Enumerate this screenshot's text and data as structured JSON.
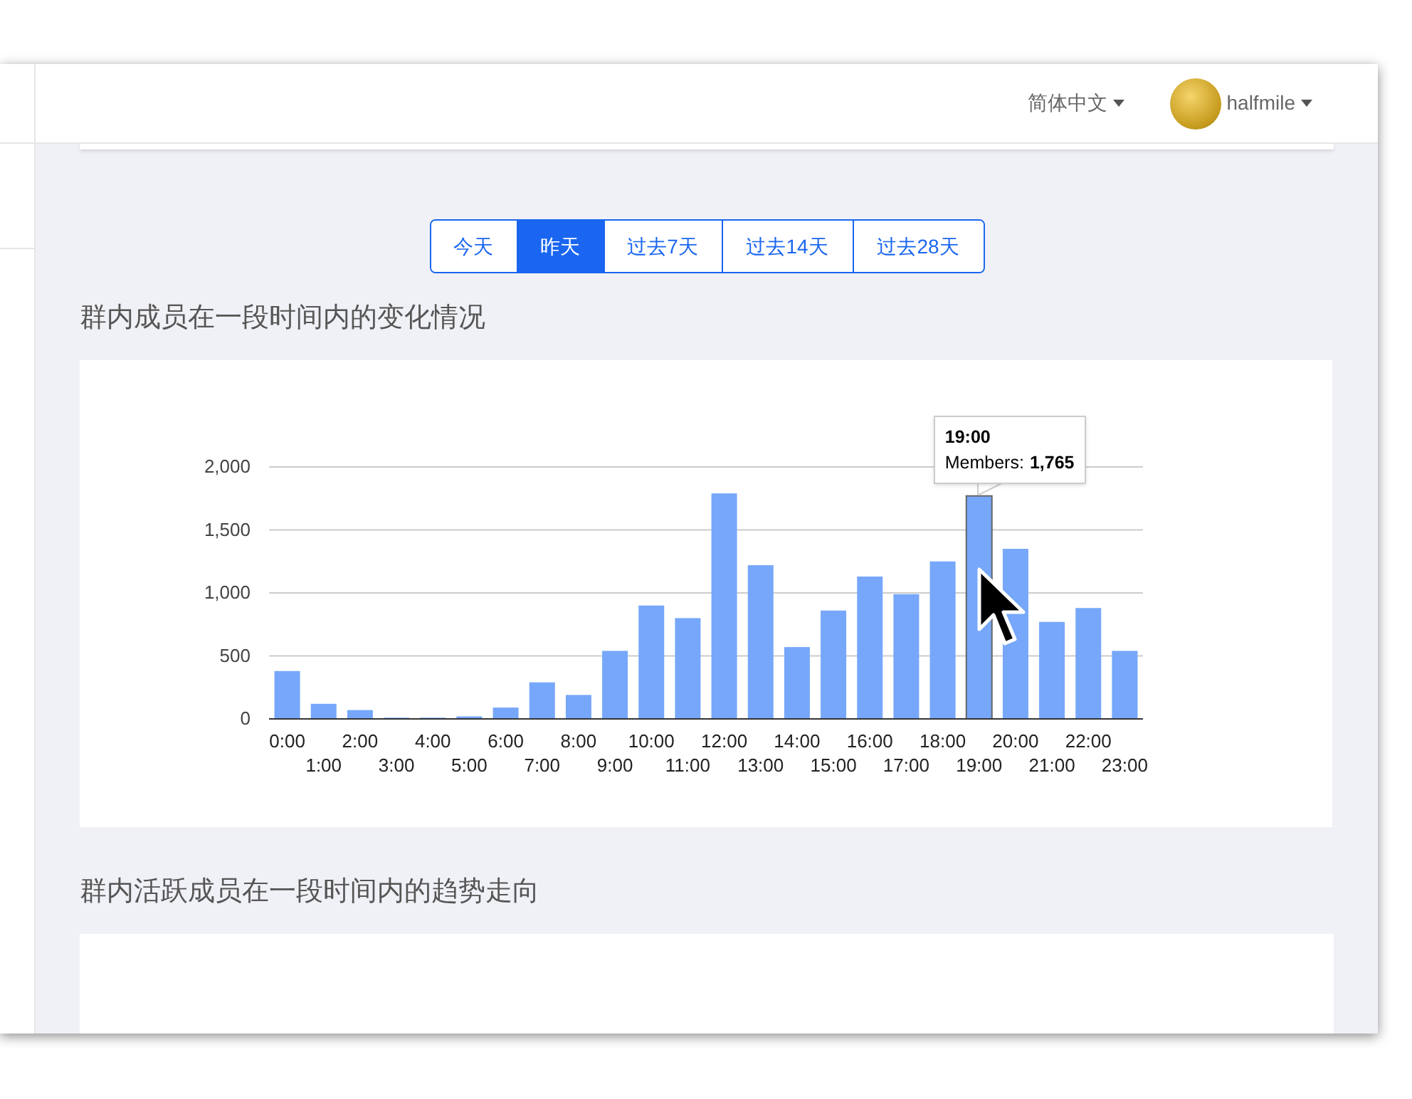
{
  "header": {
    "language": "简体中文",
    "user": "halfmile"
  },
  "range_tabs": [
    {
      "label": "今天",
      "selected": false
    },
    {
      "label": "昨天",
      "selected": true
    },
    {
      "label": "过去7天",
      "selected": false
    },
    {
      "label": "过去14天",
      "selected": false
    },
    {
      "label": "过去28天",
      "selected": false
    }
  ],
  "sections": [
    {
      "title": "群内成员在一段时间内的变化情况",
      "tooltip": {
        "title": "19:00",
        "label": "Members:",
        "value": "1,765"
      },
      "chart_data": {
        "type": "bar",
        "categories": [
          "0:00",
          "1:00",
          "2:00",
          "3:00",
          "4:00",
          "5:00",
          "6:00",
          "7:00",
          "8:00",
          "9:00",
          "10:00",
          "11:00",
          "12:00",
          "13:00",
          "14:00",
          "15:00",
          "16:00",
          "17:00",
          "18:00",
          "19:00",
          "20:00",
          "21:00",
          "22:00",
          "23:00"
        ],
        "grid": true,
        "ylim": [
          0,
          2000
        ],
        "yticks": [
          {
            "value": 0,
            "label": "0"
          },
          {
            "value": 500,
            "label": "500"
          },
          {
            "value": 1000,
            "label": "1,000"
          },
          {
            "value": 1500,
            "label": "1,500"
          },
          {
            "value": 2000,
            "label": "2,000"
          }
        ],
        "series": [
          {
            "color": "#76a7fa",
            "values": [
              380,
              120,
              70,
              10,
              10,
              20,
              90,
              290,
              190,
              540,
              900,
              800,
              1790,
              1220,
              570,
              860,
              1130,
              990,
              1250,
              1770,
              1350,
              770,
              880,
              540
            ]
          }
        ]
      }
    },
    {
      "title": "群内活跃成员在一段时间内的趋势走向"
    }
  ]
}
